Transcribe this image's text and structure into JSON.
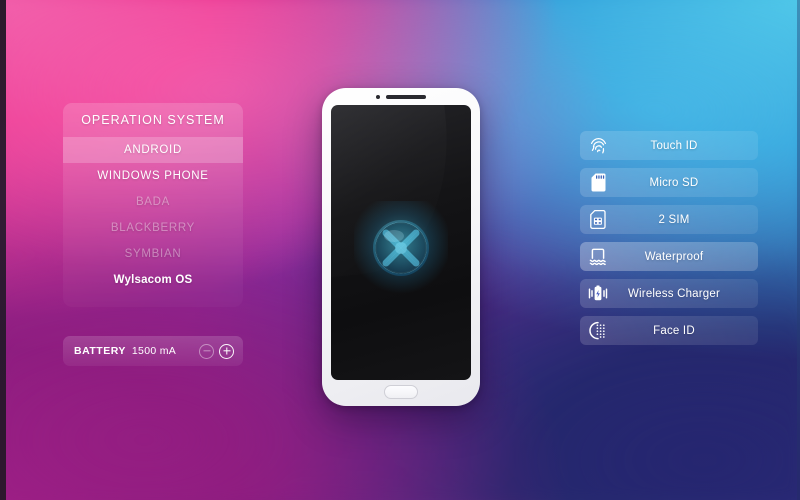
{
  "background": {
    "corner_colors": {
      "top_left": "#ec3d95",
      "top_right": "#34a4dc",
      "bottom_left": "#9e1f86",
      "bottom_right": "#2b2b77",
      "center": "#8b2fa8"
    }
  },
  "os_panel": {
    "title": "OPERATION SYSTEM",
    "items": [
      {
        "label": "ANDROID",
        "state": "selected"
      },
      {
        "label": "WINDOWS PHONE",
        "state": "normal"
      },
      {
        "label": "BADA",
        "state": "disabled"
      },
      {
        "label": "BLACKBERRY",
        "state": "disabled"
      },
      {
        "label": "SYMBIAN",
        "state": "disabled"
      },
      {
        "label": "Wylsacom OS",
        "state": "brand"
      }
    ]
  },
  "battery": {
    "label": "BATTERY",
    "value": "1500 mA",
    "decrease_icon": "minus-circle-icon",
    "increase_icon": "plus-circle-icon",
    "decrease_enabled": false,
    "increase_enabled": true
  },
  "phone": {
    "camera_icon": "front-camera-dot",
    "speaker_icon": "earpiece-speaker",
    "home_button_icon": "home-button",
    "screen_logo": "wylsacom-orb-logo",
    "logo_color": "#35c8ee"
  },
  "features": [
    {
      "label": "Touch ID",
      "icon": "fingerprint-icon",
      "active": false
    },
    {
      "label": "Micro SD",
      "icon": "sd-card-icon",
      "active": false
    },
    {
      "label": "2 SIM",
      "icon": "sim-card-icon",
      "active": false
    },
    {
      "label": "Waterproof",
      "icon": "waterproof-icon",
      "active": true
    },
    {
      "label": "Wireless Charger",
      "icon": "wireless-charging-icon",
      "active": false
    },
    {
      "label": "Face ID",
      "icon": "face-id-icon",
      "active": false
    }
  ]
}
